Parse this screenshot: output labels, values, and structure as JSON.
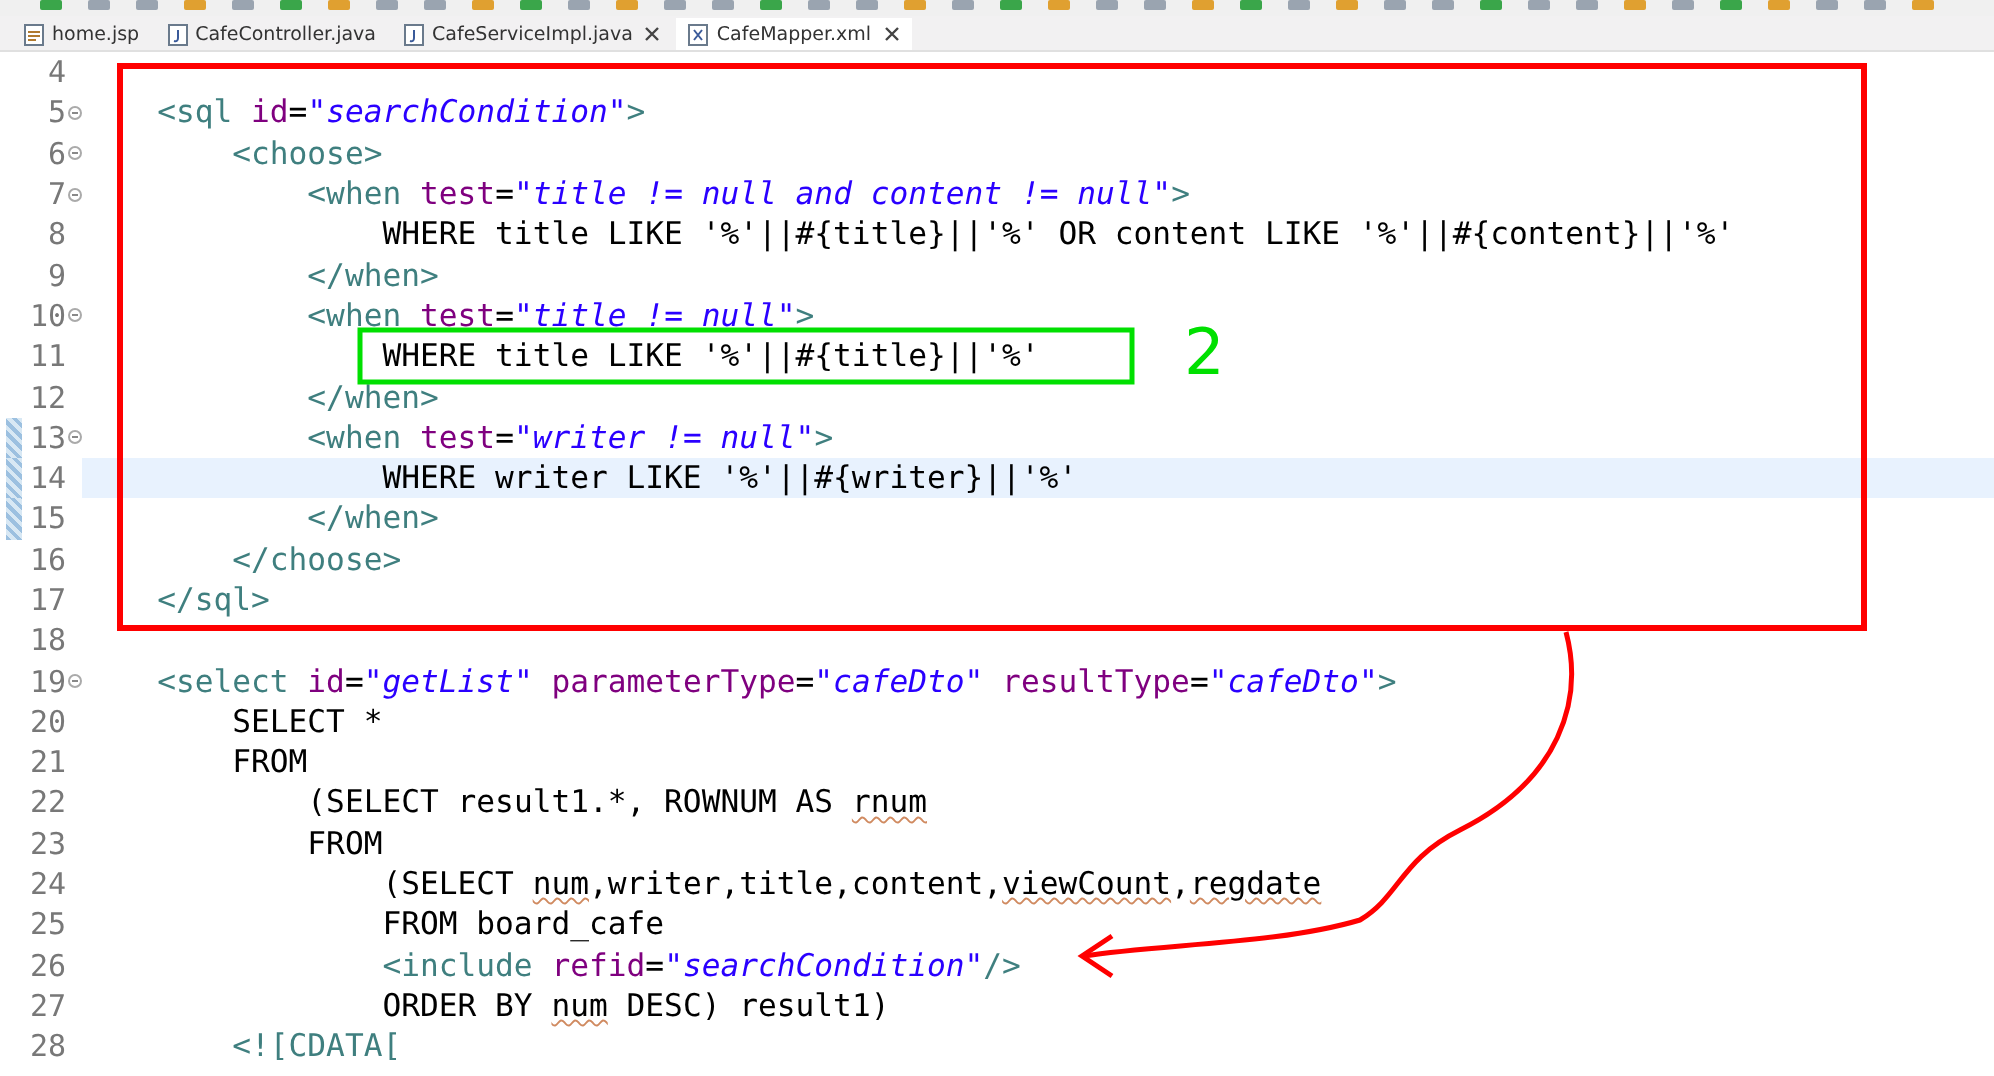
{
  "tabs": [
    {
      "label": "home.jsp",
      "kind": "jsp",
      "selected": false,
      "closable": false
    },
    {
      "label": "CafeController.java",
      "kind": "java",
      "selected": false,
      "closable": false
    },
    {
      "label": "CafeServiceImpl.java",
      "kind": "java",
      "selected": false,
      "closable": true
    },
    {
      "label": "CafeMapper.xml",
      "kind": "xml",
      "selected": true,
      "closable": true
    }
  ],
  "editor": {
    "lines": [
      {
        "number": "4",
        "fold": false,
        "changed": false,
        "current": false
      },
      {
        "number": "5",
        "fold": true,
        "changed": false,
        "current": false,
        "segments": [
          {
            "kind": "tag",
            "text": "    <sql"
          },
          {
            "kind": "attr",
            "text": " id"
          },
          {
            "kind": "plain",
            "text": "="
          },
          {
            "kind": "value",
            "text": "\"searchCondition\""
          },
          {
            "kind": "tag",
            "text": ">"
          }
        ]
      },
      {
        "number": "6",
        "fold": true,
        "changed": false,
        "current": false,
        "segments": [
          {
            "kind": "tag",
            "text": "        <choose>"
          }
        ]
      },
      {
        "number": "7",
        "fold": true,
        "changed": false,
        "current": false,
        "segments": [
          {
            "kind": "tag",
            "text": "            <when"
          },
          {
            "kind": "attr",
            "text": " test"
          },
          {
            "kind": "plain",
            "text": "="
          },
          {
            "kind": "value",
            "text": "\"title != null and content != null\""
          },
          {
            "kind": "tag",
            "text": ">"
          }
        ]
      },
      {
        "number": "8",
        "fold": false,
        "changed": false,
        "current": false,
        "segments": [
          {
            "kind": "plain",
            "text": "                WHERE title LIKE '%'||#{title}||'%' OR content LIKE '%'||#{content}||'%'"
          }
        ]
      },
      {
        "number": "9",
        "fold": false,
        "changed": false,
        "current": false,
        "segments": [
          {
            "kind": "tag",
            "text": "            </when>"
          }
        ]
      },
      {
        "number": "10",
        "fold": true,
        "changed": false,
        "current": false,
        "segments": [
          {
            "kind": "tag",
            "text": "            <when"
          },
          {
            "kind": "attr",
            "text": " test"
          },
          {
            "kind": "plain",
            "text": "="
          },
          {
            "kind": "value",
            "text": "\"title != null\""
          },
          {
            "kind": "tag",
            "text": ">"
          }
        ]
      },
      {
        "number": "11",
        "fold": false,
        "changed": false,
        "current": false,
        "segments": [
          {
            "kind": "plain",
            "text": "                WHERE title LIKE '%'||#{title}||'%'"
          }
        ]
      },
      {
        "number": "12",
        "fold": false,
        "changed": false,
        "current": false,
        "segments": [
          {
            "kind": "tag",
            "text": "            </when>"
          }
        ]
      },
      {
        "number": "13",
        "fold": true,
        "changed": true,
        "current": false,
        "segments": [
          {
            "kind": "tag",
            "text": "            <when"
          },
          {
            "kind": "attr",
            "text": " test"
          },
          {
            "kind": "plain",
            "text": "="
          },
          {
            "kind": "value",
            "text": "\"writer != null\""
          },
          {
            "kind": "tag",
            "text": ">"
          }
        ]
      },
      {
        "number": "14",
        "fold": false,
        "changed": true,
        "current": true,
        "segments": [
          {
            "kind": "plain",
            "text": "                WHERE writer LIKE '%'||#{writer}||'%'"
          }
        ]
      },
      {
        "number": "15",
        "fold": false,
        "changed": true,
        "current": false,
        "segments": [
          {
            "kind": "tag",
            "text": "            </when>"
          }
        ]
      },
      {
        "number": "16",
        "fold": false,
        "changed": false,
        "current": false,
        "segments": [
          {
            "kind": "tag",
            "text": "        </choose>"
          }
        ]
      },
      {
        "number": "17",
        "fold": false,
        "changed": false,
        "current": false,
        "segments": [
          {
            "kind": "tag",
            "text": "    </sql>"
          }
        ]
      },
      {
        "number": "18",
        "fold": false,
        "changed": false,
        "current": false
      },
      {
        "number": "19",
        "fold": true,
        "changed": false,
        "current": false,
        "segments": [
          {
            "kind": "tag",
            "text": "    <select"
          },
          {
            "kind": "attr",
            "text": " id"
          },
          {
            "kind": "plain",
            "text": "="
          },
          {
            "kind": "value",
            "text": "\"getList\""
          },
          {
            "kind": "attr",
            "text": " parameterType"
          },
          {
            "kind": "plain",
            "text": "="
          },
          {
            "kind": "value",
            "text": "\"cafeDto\""
          },
          {
            "kind": "attr",
            "text": " resultType"
          },
          {
            "kind": "plain",
            "text": "="
          },
          {
            "kind": "value",
            "text": "\"cafeDto\""
          },
          {
            "kind": "tag",
            "text": ">"
          }
        ]
      },
      {
        "number": "20",
        "fold": false,
        "changed": false,
        "current": false,
        "segments": [
          {
            "kind": "plain",
            "text": "        SELECT *"
          }
        ]
      },
      {
        "number": "21",
        "fold": false,
        "changed": false,
        "current": false,
        "segments": [
          {
            "kind": "plain",
            "text": "        FROM"
          }
        ]
      },
      {
        "number": "22",
        "fold": false,
        "changed": false,
        "current": false,
        "segments": [
          {
            "kind": "plain",
            "text": "            (SELECT result1.*, ROWNUM AS "
          },
          {
            "kind": "plain",
            "text": "rnum",
            "squiggle": true
          }
        ]
      },
      {
        "number": "23",
        "fold": false,
        "changed": false,
        "current": false,
        "segments": [
          {
            "kind": "plain",
            "text": "            FROM"
          }
        ]
      },
      {
        "number": "24",
        "fold": false,
        "changed": false,
        "current": false,
        "segments": [
          {
            "kind": "plain",
            "text": "                (SELECT "
          },
          {
            "kind": "plain",
            "text": "num",
            "squiggle": true
          },
          {
            "kind": "plain",
            "text": ",writer,title,content,"
          },
          {
            "kind": "plain",
            "text": "viewCount",
            "squiggle": true
          },
          {
            "kind": "plain",
            "text": ","
          },
          {
            "kind": "plain",
            "text": "regdate",
            "squiggle": true
          }
        ]
      },
      {
        "number": "25",
        "fold": false,
        "changed": false,
        "current": false,
        "segments": [
          {
            "kind": "plain",
            "text": "                FROM board_cafe"
          }
        ]
      },
      {
        "number": "26",
        "fold": false,
        "changed": false,
        "current": false,
        "segments": [
          {
            "kind": "tag",
            "text": "                <include"
          },
          {
            "kind": "attr",
            "text": " refid"
          },
          {
            "kind": "plain",
            "text": "="
          },
          {
            "kind": "value",
            "text": "\"searchCondition\""
          },
          {
            "kind": "tag",
            "text": "/>"
          }
        ]
      },
      {
        "number": "27",
        "fold": false,
        "changed": false,
        "current": false,
        "segments": [
          {
            "kind": "plain",
            "text": "                ORDER BY "
          },
          {
            "kind": "plain",
            "text": "num",
            "squiggle": true
          },
          {
            "kind": "plain",
            "text": " DESC) result1)"
          }
        ]
      },
      {
        "number": "28",
        "fold": false,
        "changed": false,
        "current": false,
        "segments": [
          {
            "kind": "tag",
            "text": "        <![CDATA["
          }
        ]
      }
    ]
  },
  "annotations": [
    {
      "kind": "box",
      "color": "#ff0000"
    },
    {
      "kind": "box",
      "color": "#00e000"
    },
    {
      "kind": "label",
      "text": "2",
      "color": "#00e000"
    },
    {
      "kind": "arrow",
      "color": "#ff0000"
    }
  ]
}
